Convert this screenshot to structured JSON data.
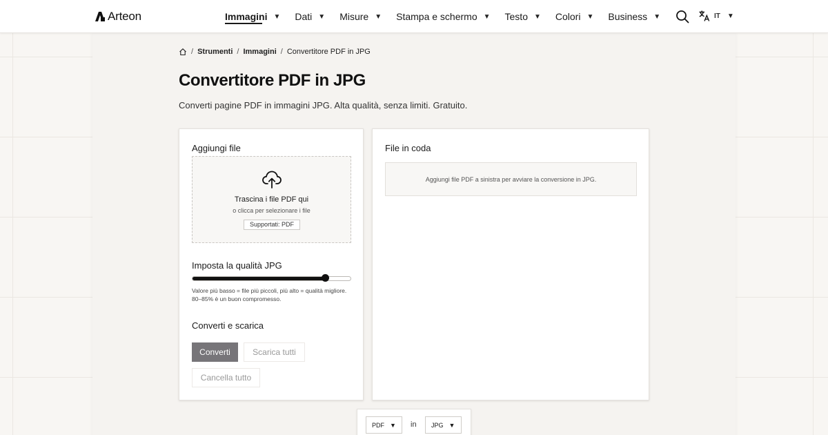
{
  "brand": {
    "name": "Arteon"
  },
  "nav": {
    "items": [
      {
        "label": "Immagini",
        "active": true
      },
      {
        "label": "Dati"
      },
      {
        "label": "Misure"
      },
      {
        "label": "Stampa e schermo"
      },
      {
        "label": "Testo"
      },
      {
        "label": "Colori"
      },
      {
        "label": "Business"
      }
    ],
    "caret": "▼"
  },
  "header": {
    "lang_code": "IT",
    "search_icon": "search-icon",
    "language_icon": "translate-icon"
  },
  "breadcrumb": {
    "home_icon": "home-icon",
    "separator": "/",
    "items": [
      "Strumenti",
      "Immagini",
      "Convertitore PDF in JPG"
    ]
  },
  "page": {
    "title": "Convertitore PDF in JPG",
    "subtitle": "Converti pagine PDF in immagini JPG. Alta qualità, senza limiti. Gratuito."
  },
  "upload": {
    "section_title": "Aggiungi file",
    "icon": "cloud-upload-icon",
    "drop_title": "Trascina i file PDF qui",
    "drop_sub": "o clicca per selezionare i file",
    "supported": "Supportati: PDF"
  },
  "quality": {
    "section_title": "Imposta la qualità JPG",
    "value": 0.84,
    "hint": "Valore più basso = file più piccoli, più alto = qualità migliore. 80–85% è un buon compromesso."
  },
  "actions": {
    "section_title": "Converti e scarica",
    "convert": "Converti",
    "download_all": "Scarica tutti",
    "clear_all": "Cancella tutto"
  },
  "queue": {
    "section_title": "File in coda",
    "empty_message": "Aggiungi file PDF a sinistra per avviare la conversione in JPG."
  },
  "format": {
    "from": "PDF",
    "connector": "in",
    "to": "JPG",
    "caret": "▼"
  },
  "colors": {
    "accent": "#111111",
    "primary_button": "#777579",
    "background": "#f8f6f3"
  }
}
